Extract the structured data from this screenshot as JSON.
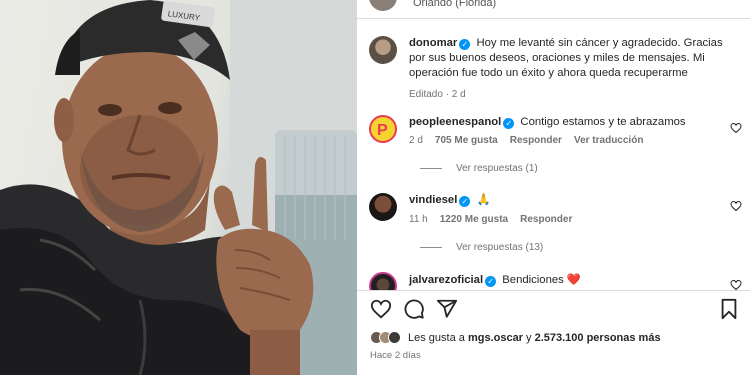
{
  "photo": {
    "alt_icon": "selfie-photo",
    "cap_text": "LUXURY"
  },
  "header": {
    "location": "Orlando (Florida)"
  },
  "caption": {
    "username": "donomar",
    "text": "Hoy me levanté sin cáncer y agradecido. Gracias por sus buenos deseos, oraciones y miles de mensajes. Mi operación fue todo un éxito y ahora queda recuperarme",
    "edited": "Editado · 2 d"
  },
  "comments": [
    {
      "username": "peopleenespanol",
      "verified": true,
      "text": "Contigo estamos y te abrazamos",
      "time": "2 d",
      "likes": "705 Me gusta",
      "reply": "Responder",
      "translate": "Ver traducción",
      "replies": "Ver respuestas (1)"
    },
    {
      "username": "vindiesel",
      "verified": true,
      "text": "🙏",
      "time": "11 h",
      "likes": "1220 Me gusta",
      "reply": "Responder",
      "replies": "Ver respuestas (13)"
    },
    {
      "username": "jalvarezoficial",
      "verified": true,
      "text": "Bendiciones ❤️"
    }
  ],
  "likes": {
    "prefix": "Les gusta a",
    "first_user": "mgs.oscar",
    "connector": "y",
    "count": "2.573.100 personas más"
  },
  "timestamp": "Hace 2 días",
  "colors": {
    "verified": "#0095f6",
    "heart_red": "#ed4956"
  },
  "icons": [
    "heart-icon",
    "comment-icon",
    "share-icon",
    "bookmark-icon"
  ]
}
